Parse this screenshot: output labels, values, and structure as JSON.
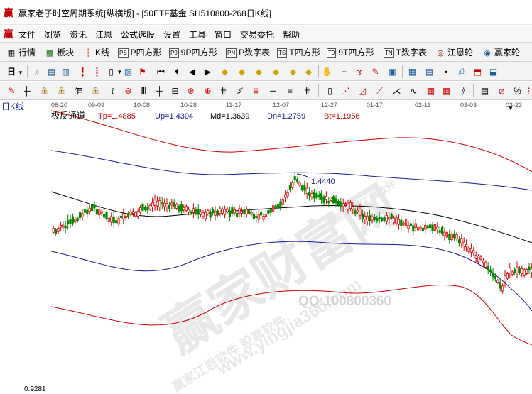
{
  "window": {
    "title": "赢家老子时空周期系统[纵横版] - [50ETF基金  SH510800-268日K线]"
  },
  "menu": {
    "items": [
      "文件",
      "浏览",
      "资讯",
      "江恩",
      "公式选股",
      "设置",
      "工具",
      "窗口",
      "交易委托",
      "帮助"
    ]
  },
  "toolbar1": {
    "items": [
      {
        "label": "行情",
        "icon": "grid-icon",
        "badge": ""
      },
      {
        "label": "板块",
        "icon": "sector-icon",
        "badge": ""
      },
      {
        "label": "K线",
        "icon": "kline-icon",
        "badge": ""
      },
      {
        "label": "P四方形",
        "icon": "p-square-icon",
        "badge": "PS"
      },
      {
        "label": "9P四方形",
        "icon": "9p-square-icon",
        "badge": "P9"
      },
      {
        "label": "P数字表",
        "icon": "p-table-icon",
        "badge": "PN"
      },
      {
        "label": "T四方形",
        "icon": "t-square-icon",
        "badge": "TS"
      },
      {
        "label": "9T四方形",
        "icon": "9t-square-icon",
        "badge": "T9"
      },
      {
        "label": "T数字表",
        "icon": "t-table-icon",
        "badge": "TN"
      },
      {
        "label": "江恩轮",
        "icon": "gann-wheel-icon",
        "badge": ""
      },
      {
        "label": "赢家轮",
        "icon": "winner-wheel-icon",
        "badge": ""
      }
    ]
  },
  "toolbar2": {
    "period_label": "日",
    "icons": [
      "search-icon",
      "layout-icon",
      "doc-icon",
      "bars-icon",
      "bars2-icon",
      "candle-icon",
      "chevron-icon",
      "bmp-icon",
      "flag-icon",
      "first-icon",
      "prev-icon",
      "back-icon",
      "forward-icon",
      "diamond1-icon",
      "diamond2-icon",
      "diamond3-icon",
      "diamond4-icon",
      "diamond5-icon",
      "diamond6-icon",
      "hand-icon",
      "crosshair-icon",
      "draw-icon",
      "eraser-icon",
      "calc-icon",
      "calendar-icon",
      "list-icon",
      "save-icon",
      "print-icon",
      "export-icon"
    ]
  },
  "toolbar3": {
    "icons": [
      "pencil-icon",
      "ruler-icon",
      "golden1-icon",
      "golden2-icon",
      "fan-icon",
      "tool6-icon",
      "tool7-icon",
      "arc-icon",
      "circle-icon",
      "grid2-icon",
      "tool11-icon",
      "tool12-icon",
      "tool13-icon",
      "tool14-icon",
      "tool15-icon",
      "tool16-icon",
      "tool17-icon",
      "tool18-icon",
      "tool19-icon",
      "tool20-icon",
      "tool21-icon",
      "tool22-icon",
      "tool23-icon",
      "tool24-icon",
      "tool25-icon",
      "tool26-icon",
      "tool27-icon",
      "tool28-icon",
      "tool29-icon",
      "tool30-icon",
      "tool31-icon",
      "percent-icon",
      "tool33-icon"
    ],
    "percent_label": "%"
  },
  "chart": {
    "panel_label": "日K线",
    "indicator_name": "极反通道",
    "tp_label": "Tp=1.4885",
    "up_label": "Up=1.4304",
    "md_label": "Md=1.3639",
    "dn_label": "Dn=1.2759",
    "bt_label": "Bt=1.1956",
    "date_ticks": [
      "08-20",
      "09-09",
      "10-08",
      "10-28",
      "11-17",
      "12-07",
      "12-27",
      "01-17",
      "02-11",
      "03-03",
      "03-23"
    ],
    "peak_label": "1.4440",
    "bottom_value": "0.9281",
    "watermark_main": "赢家财富网",
    "watermark_url": "www.yingjia360.com",
    "watermark_sub1": "赢家江恩软件 股票软件",
    "watermark_sub2": "赢家江恩工具软件",
    "watermark_qq": "QQ:100800360",
    "colors": {
      "tp": "#cc0000",
      "up": "#1a1a9a",
      "md": "#000000",
      "dn": "#1a1a9a",
      "bt": "#cc0000",
      "bull": "#dd0000",
      "bear": "#008800"
    }
  }
}
